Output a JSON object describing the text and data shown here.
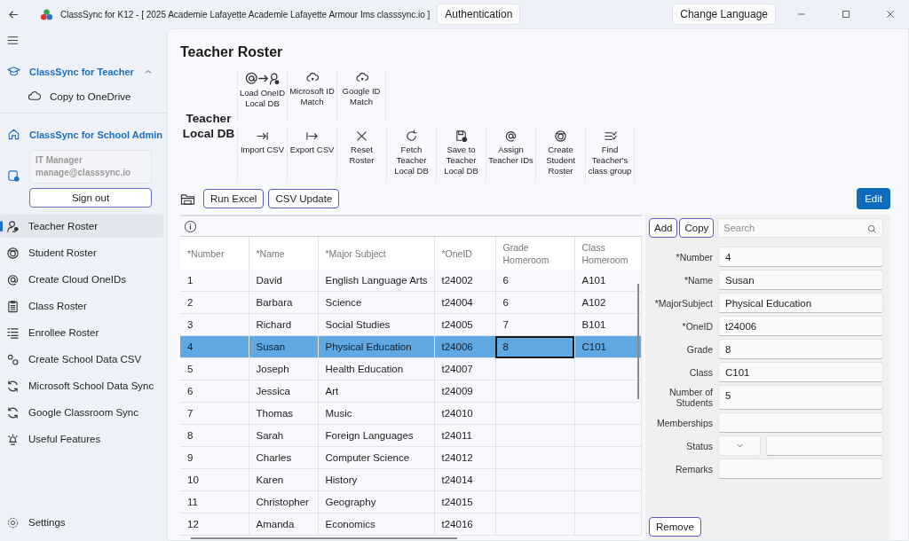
{
  "title_bar": {
    "app_title": "ClassSync for K12 - [ 2025 Academie Lafayette Academie Lafayette Armour Ims classsync.io ]",
    "auth_button": "Authentication",
    "language_button": "Change Language"
  },
  "sidebar": {
    "teacher_section": {
      "label": "ClassSync for Teacher",
      "expanded": true,
      "items": [
        "Copy to OneDrive"
      ]
    },
    "admin_section": {
      "label": "ClassSync for School Admin",
      "account_name": "IT Manager",
      "account_email": "manage@classsync.io",
      "sign_out": "Sign out"
    },
    "items": [
      {
        "label": "Teacher Roster",
        "selected": true
      },
      {
        "label": "Student Roster",
        "selected": false
      },
      {
        "label": "Create Cloud OneIDs",
        "selected": false
      },
      {
        "label": "Class Roster",
        "selected": false
      },
      {
        "label": "Enrollee Roster",
        "selected": false
      },
      {
        "label": "Create School Data CSV",
        "selected": false
      },
      {
        "label": "Microsoft School Data Sync",
        "selected": false
      },
      {
        "label": "Google Classroom Sync",
        "selected": false
      },
      {
        "label": "Useful Features",
        "selected": false
      }
    ],
    "settings": "Settings"
  },
  "main": {
    "title": "Teacher Roster",
    "ribbon": {
      "group_label": "Teacher Local DB",
      "row_1": [
        "Load OneID Local DB",
        "Microsoft ID Match",
        "Google ID Match"
      ],
      "row_2": [
        "Import CSV",
        "Export CSV",
        "Reset Roster",
        "Fetch Teacher Local DB",
        "Save to Teacher Local DB",
        "Assign Teacher IDs",
        "Create Student Roster",
        "Find Teacher's class group"
      ]
    },
    "toolbar": {
      "run_excel": "Run Excel",
      "csv_update": "CSV Update",
      "edit": "Edit"
    },
    "table": {
      "columns": [
        "*Number",
        "*Name",
        "*Major Subject",
        "*OneID",
        "Grade Homeroom",
        "Class Homeroom"
      ],
      "rows": [
        {
          "number": "1",
          "name": "David",
          "major_subject": "English Language Arts",
          "one_id": "t24002",
          "grade": "6",
          "class": "A101",
          "selected": false,
          "grade_focused": false
        },
        {
          "number": "2",
          "name": "Barbara",
          "major_subject": "Science",
          "one_id": "t24004",
          "grade": "6",
          "class": "A102",
          "selected": false,
          "grade_focused": false
        },
        {
          "number": "3",
          "name": "Richard",
          "major_subject": "Social Studies",
          "one_id": "t24005",
          "grade": "7",
          "class": "B101",
          "selected": false,
          "grade_focused": false
        },
        {
          "number": "4",
          "name": "Susan",
          "major_subject": "Physical Education",
          "one_id": "t24006",
          "grade": "8",
          "class": "C101",
          "selected": true,
          "grade_focused": true
        },
        {
          "number": "5",
          "name": "Joseph",
          "major_subject": "Health Education",
          "one_id": "t24007",
          "selected": false,
          "grade_focused": false
        },
        {
          "number": "6",
          "name": "Jessica",
          "major_subject": "Art",
          "one_id": "t24009",
          "selected": false,
          "grade_focused": false
        },
        {
          "number": "7",
          "name": "Thomas",
          "major_subject": "Music",
          "one_id": "t24010",
          "selected": false,
          "grade_focused": false
        },
        {
          "number": "8",
          "name": "Sarah",
          "major_subject": "Foreign Languages",
          "one_id": "t24011",
          "selected": false,
          "grade_focused": false
        },
        {
          "number": "9",
          "name": "Charles",
          "major_subject": "Computer Science",
          "one_id": "t24012",
          "selected": false,
          "grade_focused": false
        },
        {
          "number": "10",
          "name": "Karen",
          "major_subject": "History",
          "one_id": "t24014",
          "selected": false,
          "grade_focused": false
        },
        {
          "number": "11",
          "name": "Christopher",
          "major_subject": "Geography",
          "one_id": "t24015",
          "selected": false,
          "grade_focused": false
        },
        {
          "number": "12",
          "name": "Amanda",
          "major_subject": "Economics",
          "one_id": "t24016",
          "selected": false,
          "grade_focused": false
        }
      ]
    },
    "detail": {
      "add": "Add",
      "copy": "Copy",
      "search_placeholder": "Search",
      "fields": [
        {
          "label": "*Number",
          "value": "4",
          "kind": "text"
        },
        {
          "label": "*Name",
          "value": "Susan",
          "kind": "text"
        },
        {
          "label": "*MajorSubject",
          "value": "Physical Education",
          "kind": "text"
        },
        {
          "label": "*OneID",
          "value": "t24006",
          "kind": "text"
        },
        {
          "label": "Grade",
          "value": "8",
          "kind": "text"
        },
        {
          "label": "Class",
          "value": "C101",
          "kind": "text"
        },
        {
          "label": "Number of Students",
          "value": "5",
          "kind": "tall"
        },
        {
          "label": "Memberships",
          "kind": "text"
        },
        {
          "label": "Status",
          "kind": "select"
        },
        {
          "label": "Remarks",
          "kind": "text"
        }
      ],
      "remove": "Remove"
    }
  }
}
